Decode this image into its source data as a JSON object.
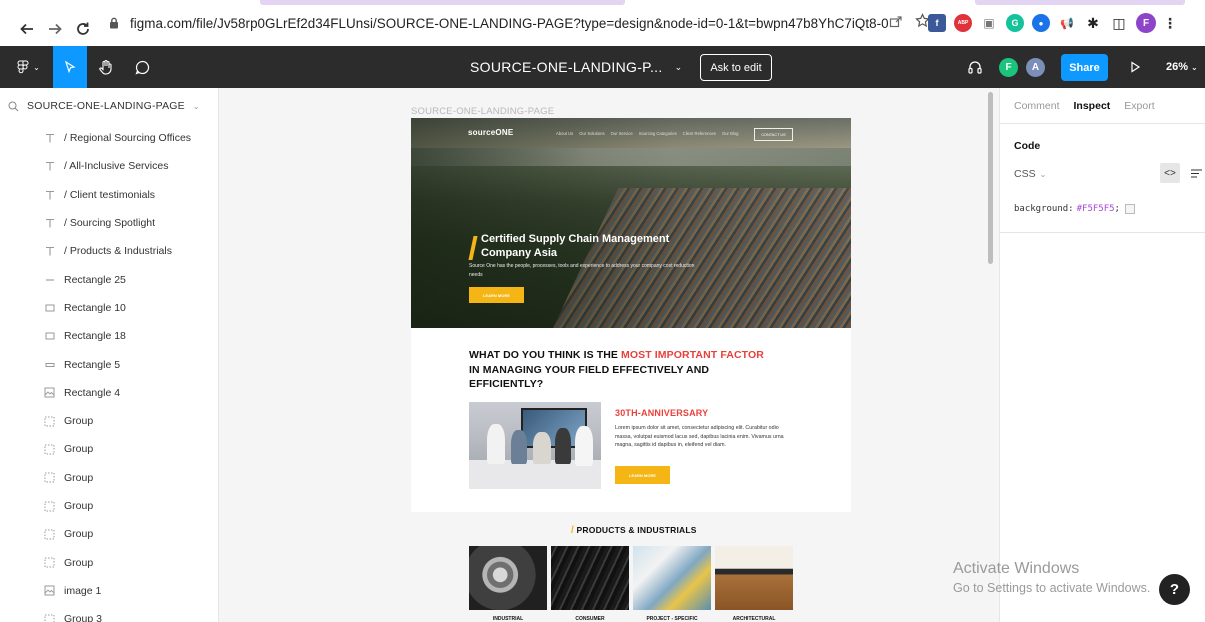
{
  "browser": {
    "url": "figma.com/file/Jv58rp0GLrEf2d34FLUnsi/SOURCE-ONE-LANDING-PAGE?type=design&node-id=0-1&t=bwpn47b8YhC7iQt8-0",
    "extensions": [
      {
        "name": "facebook-ext",
        "label": "f",
        "color": "#3b5998"
      },
      {
        "name": "adblock-ext",
        "label": "ABP",
        "color": "#e0323a"
      },
      {
        "name": "screen-ext",
        "label": "▣",
        "color": "#777777"
      },
      {
        "name": "grammarly-ext",
        "label": "G",
        "color": "#15c39a"
      },
      {
        "name": "blue-ext",
        "label": "●",
        "color": "#1a73e8"
      },
      {
        "name": "megaphone-ext",
        "label": "📢",
        "color": "#ffffff"
      },
      {
        "name": "puzzle-ext",
        "label": "✱",
        "color": "#ffffff"
      },
      {
        "name": "sidepanel-ext",
        "label": "◫",
        "color": "#ffffff"
      }
    ],
    "profile_initial": "F"
  },
  "toolbar": {
    "file_title": "SOURCE-ONE-LANDING-P...",
    "ask_to_edit": "Ask to edit",
    "avatar_1": "F",
    "avatar_2": "A",
    "share_label": "Share",
    "zoom_label": "26%"
  },
  "left_panel": {
    "page_name": "SOURCE-ONE-LANDING-PAGE",
    "layers": [
      {
        "type": "text",
        "label": "/ Regional Sourcing Offices"
      },
      {
        "type": "text",
        "label": "/ All-Inclusive Services"
      },
      {
        "type": "text",
        "label": "/ Client testimonials"
      },
      {
        "type": "text",
        "label": "/ Sourcing Spotlight"
      },
      {
        "type": "text",
        "label": "/ Products & Industrials"
      },
      {
        "type": "line",
        "label": "Rectangle 25"
      },
      {
        "type": "rect",
        "label": "Rectangle 10"
      },
      {
        "type": "rect",
        "label": "Rectangle 18"
      },
      {
        "type": "rect-thin",
        "label": "Rectangle 5"
      },
      {
        "type": "image",
        "label": "Rectangle 4"
      },
      {
        "type": "group",
        "label": "Group"
      },
      {
        "type": "group",
        "label": "Group"
      },
      {
        "type": "group",
        "label": "Group"
      },
      {
        "type": "group",
        "label": "Group"
      },
      {
        "type": "group",
        "label": "Group"
      },
      {
        "type": "group",
        "label": "Group"
      },
      {
        "type": "image",
        "label": "image 1"
      },
      {
        "type": "group",
        "label": "Group 3"
      }
    ]
  },
  "canvas": {
    "frame_label": "SOURCE-ONE-LANDING-PAGE",
    "hero": {
      "logo": "sourceONE",
      "nav_links": [
        "About Us",
        "Our Solutions",
        "Our Service",
        "Sourcing Categories",
        "Client References",
        "Our Blog"
      ],
      "contact_label": "CONTACT US",
      "title_line1": "Certified Supply Chain Management",
      "title_line2": "Company Asia",
      "subtitle": "Source One has the people, processes, tools and experience to address your company cost reduction needs",
      "cta": "LEARN MORE"
    },
    "question": {
      "part1": "WHAT DO YOU THINK IS THE ",
      "highlight_1": "MOST IMPORTANT",
      "highlight_2": "FACTOR",
      "part2": " IN MANAGING YOUR FIELD EFFECTIVELY AND EFFICIENTLY?"
    },
    "anniversary": {
      "title": "30TH-ANNIVERSARY",
      "text": "Lorem ipsum dolor sit amet, consectetur adipiscing elit. Curabitur odio massa, volutpat euismod lacus sed, dapibus lacinia enim. Vivamus urna magna, sagittis id dapibus in, eleifend vel diam.",
      "cta": "LEARN MORE"
    },
    "products": {
      "title": "PRODUCTS & INDUSTRIALS",
      "items": [
        {
          "label": "INDUSTRIAL"
        },
        {
          "label": "CONSUMER"
        },
        {
          "label": "PROJECT - SPECIFIC"
        },
        {
          "label": "ARCHITECTURAL"
        }
      ]
    }
  },
  "right_panel": {
    "tabs": [
      "Comment",
      "Inspect",
      "Export"
    ],
    "active_tab": "Inspect",
    "section_title": "Code",
    "language": "CSS",
    "css_property": "background:",
    "css_value": "#F5F5F5",
    "css_semicolon": ";"
  },
  "overlay": {
    "activate_title": "Activate Windows",
    "activate_sub": "Go to Settings to activate Windows.",
    "help_label": "?"
  }
}
